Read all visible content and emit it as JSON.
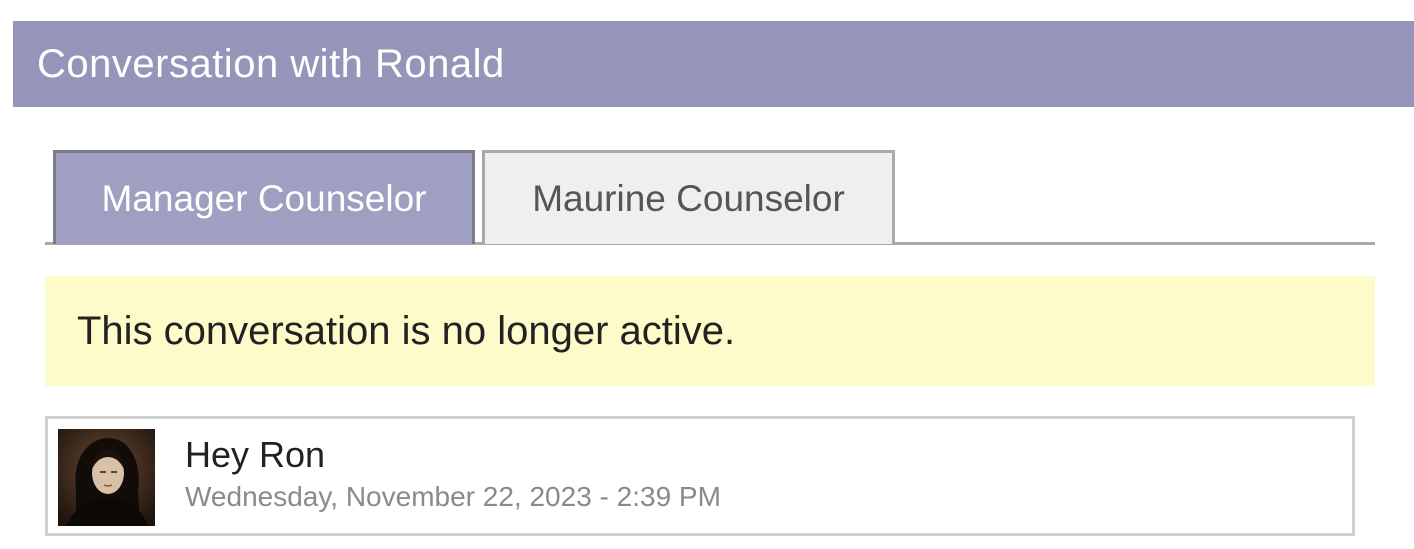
{
  "header": {
    "title": "Conversation with Ronald"
  },
  "tabs": [
    {
      "label": "Manager Counselor",
      "active": true
    },
    {
      "label": "Maurine Counselor",
      "active": false
    }
  ],
  "notice": {
    "text": "This conversation is no longer active."
  },
  "messages": [
    {
      "text": "Hey Ron",
      "timestamp": "Wednesday, November 22, 2023 - 2:39 PM",
      "avatar": "user-portrait"
    }
  ],
  "colors": {
    "header_bg": "#9495b8",
    "tab_active_bg": "#9fa0c1",
    "tab_inactive_bg": "#efefef",
    "notice_bg": "#fdfbc9"
  }
}
